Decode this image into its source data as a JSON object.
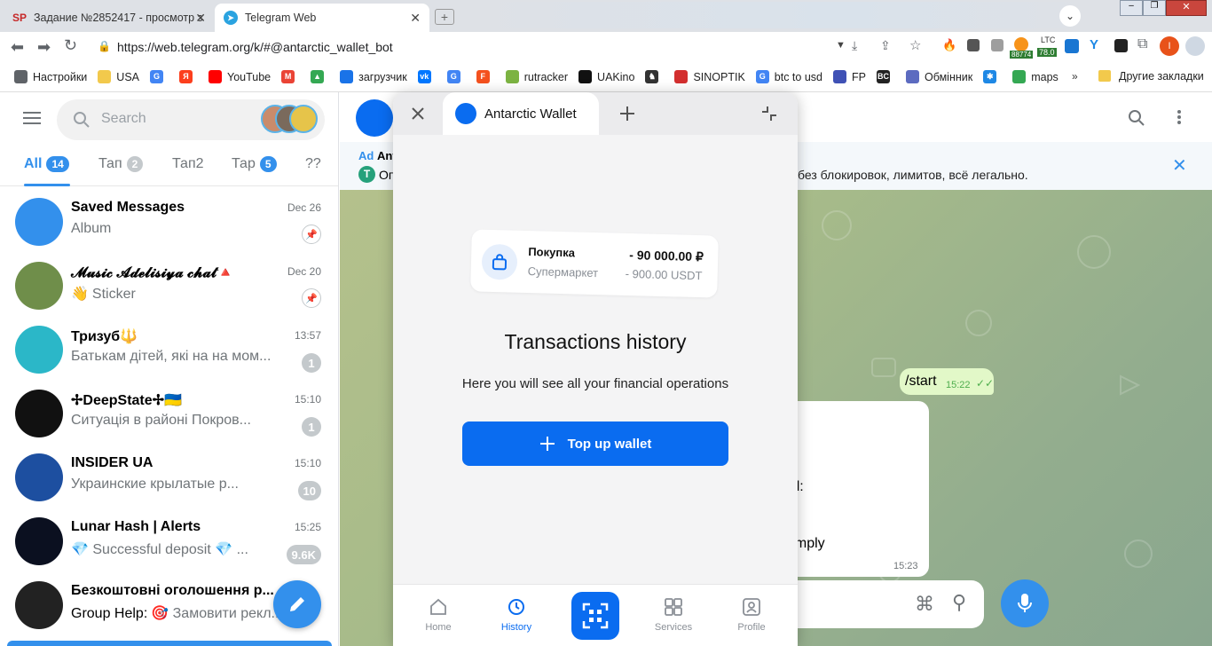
{
  "tabs": [
    {
      "icon": "SP",
      "title": "Задание №2852417 - просмотр з"
    },
    {
      "icon": "telegram-icon",
      "title": "Telegram Web"
    }
  ],
  "address": {
    "url": "https://web.telegram.org/k/#@antarctic_wallet_bot"
  },
  "extensions": {
    "ltc_label": "LTC",
    "ltc_value": "78.0",
    "price_badge": "88774"
  },
  "bookmarks": [
    {
      "label": "Настройки",
      "color": "#5f6368"
    },
    {
      "label": "USA",
      "color": "#f2c94c"
    },
    {
      "label": "",
      "color": "#4285f4",
      "icon": "G"
    },
    {
      "label": "",
      "color": "#fc3f1d",
      "icon": "Я"
    },
    {
      "label": "YouTube",
      "color": "#ff0000"
    },
    {
      "label": "",
      "color": "#ea4335",
      "icon": "M"
    },
    {
      "label": "",
      "color": "#34a853",
      "icon": "▲"
    },
    {
      "label": "загрузчик",
      "color": "#1a73e8"
    },
    {
      "label": "",
      "color": "#0077ff",
      "icon": "vk"
    },
    {
      "label": "",
      "color": "#4285f4",
      "icon": "G"
    },
    {
      "label": "",
      "color": "#f4511e",
      "icon": "F"
    },
    {
      "label": "rutracker",
      "color": "#7cb342"
    },
    {
      "label": "UAKino",
      "color": "#111"
    },
    {
      "label": "",
      "color": "#333",
      "icon": "♞"
    },
    {
      "label": "SINOPTIK",
      "color": "#d32f2f"
    },
    {
      "label": "btc to usd",
      "color": "#4285f4",
      "icon": "G"
    },
    {
      "label": "FP",
      "color": "#3f51b5"
    },
    {
      "label": "",
      "color": "#222",
      "icon": "BC"
    },
    {
      "label": "Обмінник",
      "color": "#5c6bc0"
    },
    {
      "label": "",
      "color": "#1e88e5",
      "icon": "✱"
    },
    {
      "label": "maps",
      "color": "#34a853"
    }
  ],
  "bookmarks_more": "Другие закладки",
  "sidebar": {
    "search_placeholder": "Search",
    "folders": [
      {
        "label": "All",
        "count": "14"
      },
      {
        "label": "Тап",
        "count": "2"
      },
      {
        "label": "Тап2",
        "count": ""
      },
      {
        "label": "Тар",
        "count": "5"
      },
      {
        "label": "??",
        "count": ""
      }
    ],
    "chats": [
      {
        "name": "Saved Messages",
        "prefix": "",
        "msg": "Album",
        "time": "Dec 26",
        "badge": "",
        "pinned": true,
        "color": "#3390ec"
      },
      {
        "name": "𝓜𝓾𝓼𝓲𝓬 𝓐𝓭𝓮𝓵𝓲𝓼𝓲𝔂𝓪 𝓬𝓱𝓪𝓽🔺",
        "prefix": "👋",
        "msg": "Sticker",
        "time": "Dec 20",
        "badge": "",
        "pinned": true,
        "color": "#6f8e4a"
      },
      {
        "name": "Тризуб🔱",
        "prefix": "",
        "msg": "Батькам дітей, які на на мом...",
        "time": "13:57",
        "badge": "1",
        "pinned": false,
        "color": "#2bb7c8"
      },
      {
        "name": "✢DeepState✢🇺🇦",
        "prefix": "",
        "msg": "Ситуація в районі Покров...",
        "time": "15:10",
        "badge": "1",
        "pinned": false,
        "color": "#111111"
      },
      {
        "name": "INSIDER UA",
        "prefix": "",
        "msg": "Украинские крылатые р...",
        "time": "15:10",
        "badge": "10",
        "pinned": false,
        "color": "#1d4fa0"
      },
      {
        "name": "Lunar Hash | Alerts",
        "prefix": "",
        "msg": "💎 Successful deposit 💎 ...",
        "time": "15:25",
        "badge": "9.6K",
        "pinned": false,
        "color": "#0b1020"
      },
      {
        "name": "Безкоштовні оголошення р...",
        "prefix": "Group Help:",
        "msg": "🎯 Замовити рекл...",
        "time": "",
        "badge": "",
        "pinned": false,
        "color": "#222222"
      }
    ]
  },
  "chat": {
    "banner_ad": "Ad",
    "banner_title": "Ant",
    "banner_text": "без блокировок, лимитов, всё легально.",
    "banner_sub": "Оп",
    "out_msg": "/start",
    "out_time": "15:22",
    "in_line1": "nnel:",
    "in_line2": "n simply",
    "in_time": "15:23"
  },
  "wallet": {
    "title": "Antarctic Wallet",
    "card": {
      "title": "Покупка",
      "subtitle": "Супермаркет",
      "amount": "- 90 000.00 ₽",
      "amount_sub": "- 900.00 USDT"
    },
    "heading": "Transactions history",
    "subheading": "Here you will see all your financial operations",
    "topup": "Top up wallet",
    "nav": [
      {
        "label": "Home",
        "icon": "home-icon"
      },
      {
        "label": "History",
        "icon": "history-icon"
      },
      {
        "label": "",
        "icon": "qr-scan-icon"
      },
      {
        "label": "Services",
        "icon": "services-icon"
      },
      {
        "label": "Profile",
        "icon": "profile-icon"
      }
    ],
    "accent": "#0a6cf0"
  }
}
